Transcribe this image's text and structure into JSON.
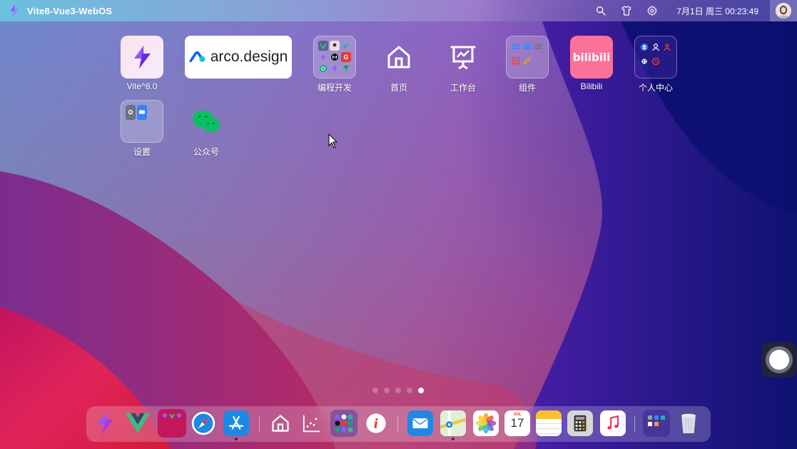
{
  "topbar": {
    "app_title": "Vite8-Vue3-WebOS",
    "clock": "7月1日 周三 00:23:49"
  },
  "desktop": {
    "icons": [
      {
        "label": "Vite^8.0"
      },
      {
        "label": "arco.design"
      },
      {
        "label": "编程开发"
      },
      {
        "label": "首页"
      },
      {
        "label": "工作台"
      },
      {
        "label": "组件"
      },
      {
        "label": "Bilibili"
      },
      {
        "label": "个人中心"
      },
      {
        "label": "设置"
      },
      {
        "label": "公众号"
      }
    ],
    "arco_logo_text": "arco.design"
  },
  "dock": {
    "calendar_month": "JUL",
    "calendar_day": "17"
  },
  "pagination": {
    "pages": 5,
    "active": 5
  },
  "colors": {
    "vite_purple": "#8b5cf6",
    "bilibili_pink": "#fb7299",
    "wechat_green": "#07c160",
    "arco_blue": "#165dff"
  }
}
